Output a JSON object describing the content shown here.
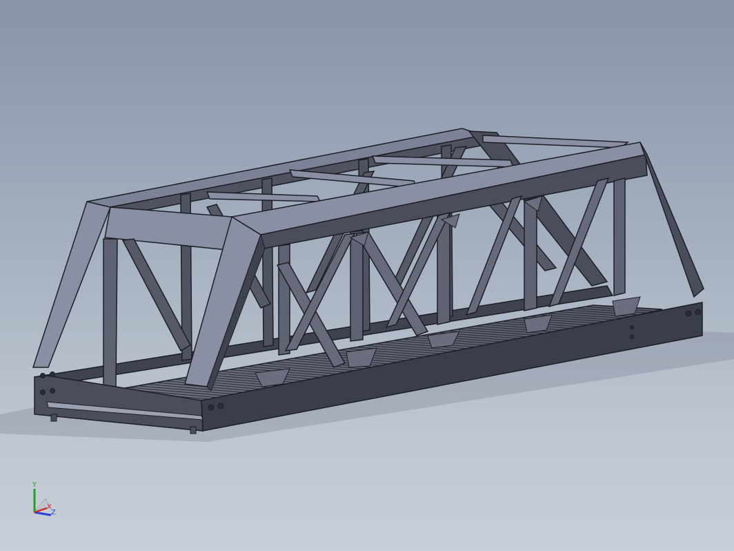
{
  "viewport": {
    "background_top": "#8794a9",
    "background_bottom": "#c9cfd8"
  },
  "model": {
    "part": "truss-bridge",
    "face_color": "#4a4e5c",
    "light_face_color": "#8a8fa3",
    "edge_color": "#1c1e26"
  },
  "triad": {
    "x_label": "X",
    "y_label": "Y",
    "z_label": "Z",
    "x_color": "#d22020",
    "y_color": "#1fa21f",
    "z_color": "#2a3fd6"
  }
}
